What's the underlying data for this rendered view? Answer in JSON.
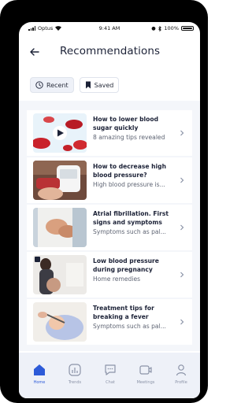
{
  "status_bar": {
    "carrier": "Optus",
    "time": "9:41 AM",
    "battery": "100%"
  },
  "header": {
    "title": "Recommendations"
  },
  "filters": [
    {
      "label": "Recent",
      "icon": "clock-icon",
      "active": true
    },
    {
      "label": "Saved",
      "icon": "bookmark-icon",
      "active": false
    }
  ],
  "items": [
    {
      "title_line1": "How to lower blood",
      "title_line2": "sugar quickly",
      "subtitle": "8 amazing tips revealed",
      "thumbnail": "blood-cells-video-thumbnail"
    },
    {
      "title_line1": "How to decrease high",
      "title_line2": "blood pressure?",
      "subtitle": "High blood pressure is...",
      "thumbnail": "blood-pressure-monitor-thumbnail"
    },
    {
      "title_line1": "Atrial fibrillation. First",
      "title_line2": "signs and symptoms",
      "subtitle": "Symptoms such as pal...",
      "thumbnail": "chest-pain-thumbnail"
    },
    {
      "title_line1": "Low blood pressure",
      "title_line2": "during pregnancy",
      "subtitle": "Home remedies",
      "thumbnail": "pregnant-woman-thumbnail"
    },
    {
      "title_line1": "Treatment tips for",
      "title_line2": "breaking a fever",
      "subtitle": "Symptoms such as pal...",
      "thumbnail": "child-thermometer-thumbnail"
    }
  ],
  "tabs": [
    {
      "label": "Home",
      "icon": "home-icon",
      "active": true
    },
    {
      "label": "Trends",
      "icon": "trends-icon",
      "active": false
    },
    {
      "label": "Chat",
      "icon": "chat-icon",
      "active": false
    },
    {
      "label": "Meetings",
      "icon": "video-call-icon",
      "active": false
    },
    {
      "label": "Profile",
      "icon": "profile-icon",
      "active": false
    }
  ],
  "colors": {
    "accent": "#2d5bd8",
    "text": "#1c2237",
    "muted": "#8b93a7",
    "tabbar_bg": "#eef1f8"
  }
}
